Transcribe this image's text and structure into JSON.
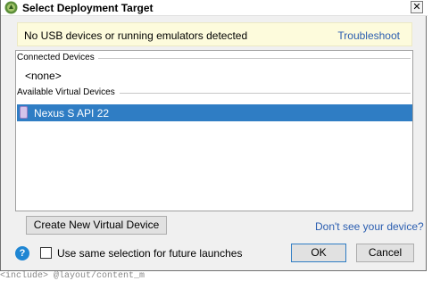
{
  "window": {
    "title": "Select Deployment Target",
    "close_glyph": "✕"
  },
  "banner": {
    "message": "No USB devices or running emulators detected",
    "link": "Troubleshoot"
  },
  "device_list": {
    "connected_header": "Connected Devices",
    "connected_empty": "<none>",
    "available_header": "Available Virtual Devices",
    "virtual_devices": [
      {
        "name": "Nexus S API 22",
        "selected": true,
        "icon": "phone-icon"
      }
    ]
  },
  "actions": {
    "create_device": "Create New Virtual Device",
    "dont_see_link": "Don't see your device?",
    "help_glyph": "?",
    "checkbox_label": "Use same selection for future launches",
    "checkbox_checked": false,
    "ok": "OK",
    "cancel": "Cancel"
  },
  "background_text": "<include> @layout/content_m",
  "colors": {
    "selection": "#2f7dc4",
    "link": "#2a5db0",
    "banner_bg": "#fdfbdc"
  }
}
